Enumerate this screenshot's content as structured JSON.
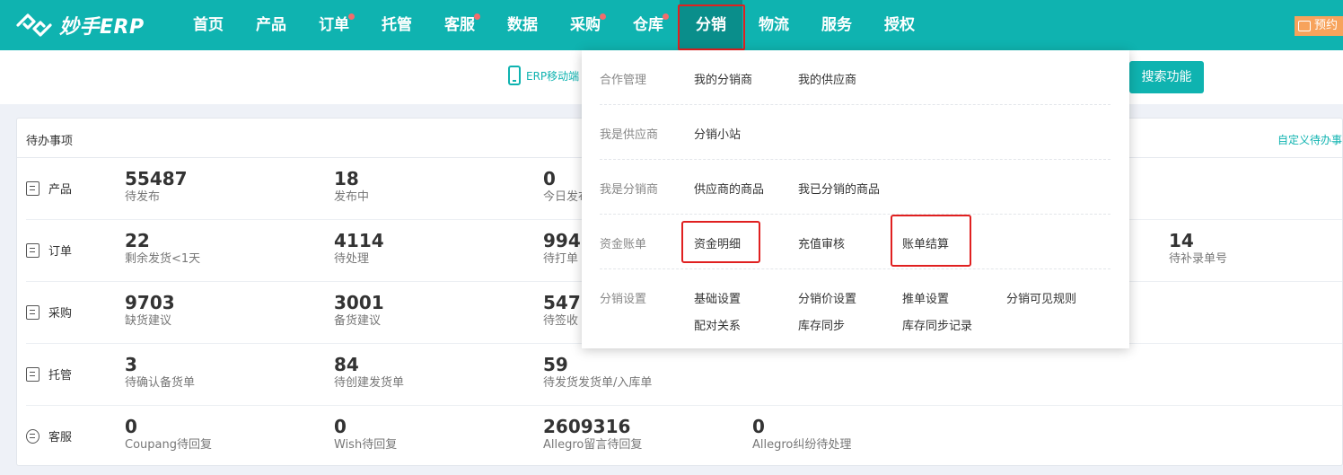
{
  "brand": {
    "name": "妙手ERP"
  },
  "nav": {
    "items": [
      {
        "label": "首页",
        "dot": false
      },
      {
        "label": "产品",
        "dot": false
      },
      {
        "label": "订单",
        "dot": true
      },
      {
        "label": "托管",
        "dot": false
      },
      {
        "label": "客服",
        "dot": true
      },
      {
        "label": "数据",
        "dot": false
      },
      {
        "label": "采购",
        "dot": true
      },
      {
        "label": "仓库",
        "dot": true
      },
      {
        "label": "分销",
        "dot": false,
        "active": true
      },
      {
        "label": "物流",
        "dot": false
      },
      {
        "label": "服务",
        "dot": false
      },
      {
        "label": "授权",
        "dot": false
      }
    ],
    "reserve_label": "预约"
  },
  "subbar": {
    "mobile_label": "ERP移动端",
    "search_button": "搜索功能"
  },
  "todo": {
    "title": "待办事项",
    "custom_link": "自定义待办事",
    "rows": [
      {
        "label": "产品",
        "icon": "product-icon",
        "stats": [
          {
            "value": "55487",
            "label": "待发布"
          },
          {
            "value": "18",
            "label": "发布中"
          },
          {
            "value": "0",
            "label": "今日发布"
          }
        ]
      },
      {
        "label": "订单",
        "icon": "order-icon",
        "stats": [
          {
            "value": "22",
            "label": "剩余发货<1天"
          },
          {
            "value": "4114",
            "label": "待处理"
          },
          {
            "value": "994",
            "label": "待打单"
          },
          {
            "value": "14",
            "label": "待补录单号"
          }
        ]
      },
      {
        "label": "采购",
        "icon": "purchase-icon",
        "stats": [
          {
            "value": "9703",
            "label": "缺货建议"
          },
          {
            "value": "3001",
            "label": "备货建议"
          },
          {
            "value": "547",
            "label": "待签收"
          }
        ]
      },
      {
        "label": "托管",
        "icon": "hosting-icon",
        "stats": [
          {
            "value": "3",
            "label": "待确认备货单"
          },
          {
            "value": "84",
            "label": "待创建发货单"
          },
          {
            "value": "59",
            "label": "待发货发货单/入库单"
          }
        ]
      },
      {
        "label": "客服",
        "icon": "service-icon",
        "stats": [
          {
            "value": "0",
            "label": "Coupang待回复"
          },
          {
            "value": "0",
            "label": "Wish待回复"
          },
          {
            "value": "2609316",
            "label": "Allegro留言待回复"
          },
          {
            "value": "0",
            "label": "Allegro纠纷待处理"
          }
        ]
      }
    ]
  },
  "dropdown": {
    "sections": [
      {
        "title": "合作管理",
        "links": [
          "我的分销商",
          "我的供应商"
        ]
      },
      {
        "title": "我是供应商",
        "links": [
          "分销小站"
        ]
      },
      {
        "title": "我是分销商",
        "links": [
          "供应商的商品",
          "我已分销的商品"
        ]
      },
      {
        "title": "资金账单",
        "links": [
          "资金明细",
          "充值审核",
          "账单结算"
        ]
      },
      {
        "title": "分销设置",
        "links": [
          "基础设置",
          "分销价设置",
          "推单设置",
          "分销可见规则",
          "配对关系",
          "库存同步",
          "库存同步记录"
        ]
      }
    ]
  },
  "colors": {
    "primary": "#0fb3b0",
    "active": "#0a8e8b",
    "highlight": "#e02020",
    "badge": "#f7a35c"
  }
}
